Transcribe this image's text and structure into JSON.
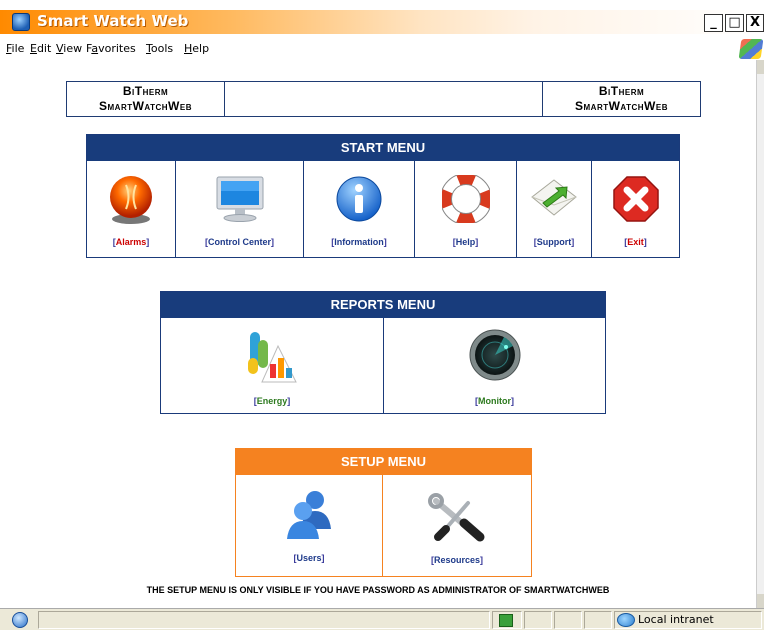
{
  "window": {
    "title": "Smart Watch Web",
    "minimize": "_",
    "restore": "□",
    "close": "X"
  },
  "menubar": [
    {
      "label": "File",
      "key": "F",
      "rest": "ile"
    },
    {
      "label": "Edit",
      "key": "E",
      "rest": "dit"
    },
    {
      "label": "View",
      "key": "V",
      "rest": "iew"
    },
    {
      "label": "Favorites",
      "key": "a",
      "pre": "F",
      "rest": "vorites"
    },
    {
      "label": "Tools",
      "key": "T",
      "rest": "ools"
    },
    {
      "label": "Help",
      "key": "H",
      "rest": "elp"
    }
  ],
  "header": {
    "left_line1": "BiTherm",
    "left_line2": "SmartWatchWeb",
    "right_line1": "BiTherm",
    "right_line2": "SmartWatchWeb"
  },
  "start_menu": {
    "title": "START MENU",
    "color": "#183c7c",
    "items": [
      {
        "label": "Alarms",
        "color": "#cc0000",
        "icon": "alarm-light-icon"
      },
      {
        "label": "Control Center",
        "color": "#1e3a8a",
        "icon": "monitor-icon"
      },
      {
        "label": "Information",
        "color": "#1e3a8a",
        "icon": "info-icon"
      },
      {
        "label": "Help",
        "color": "#1e3a8a",
        "icon": "lifebuoy-icon"
      },
      {
        "label": "Support",
        "color": "#1e3a8a",
        "icon": "envelope-arrow-icon"
      },
      {
        "label": "Exit",
        "color": "#cc0000",
        "icon": "exit-x-icon"
      }
    ]
  },
  "reports_menu": {
    "title": "REPORTS MENU",
    "color": "#183c7c",
    "items": [
      {
        "label": "Energy",
        "color": "#2d7a1f",
        "icon": "energy-chart-icon"
      },
      {
        "label": "Monitor",
        "color": "#2d7a1f",
        "icon": "radar-icon"
      }
    ]
  },
  "setup_menu": {
    "title": "SETUP MENU",
    "color": "#f58220",
    "items": [
      {
        "label": "Users",
        "color": "#1e3a8a",
        "icon": "users-icon"
      },
      {
        "label": "Resources",
        "color": "#1e3a8a",
        "icon": "tools-icon"
      }
    ]
  },
  "note": "THE SETUP MENU IS ONLY VISIBLE IF YOU HAVE PASSWORD AS ADMINISTRATOR OF SMARTWATCHWEB",
  "statusbar": {
    "zone": "Local intranet"
  }
}
